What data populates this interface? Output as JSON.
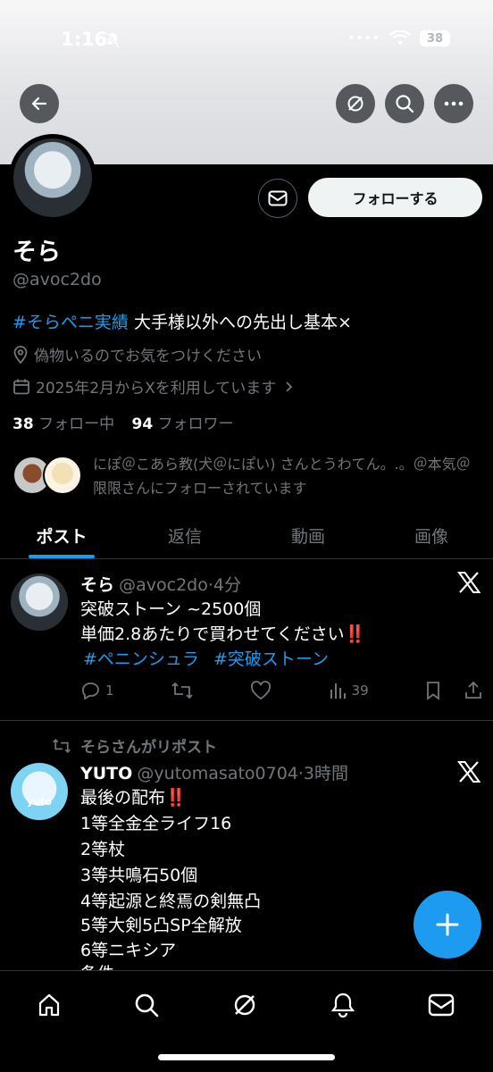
{
  "status_bar": {
    "time": "1:16",
    "battery": "38"
  },
  "profile": {
    "name": "そら",
    "handle": "@avoc2do",
    "bio_hashtag": "#そらペニ実績",
    "bio_text": " 大手様以外への先出し基本×",
    "location": "偽物いるのでお気をつけください",
    "joined": "2025年2月からXを利用しています",
    "following_count": "38",
    "following_label": " フォロー中",
    "followers_count": "94",
    "followers_label": " フォロワー",
    "followed_by": "にぽ＠こあら教(犬＠にぽい) さんとうわてん。.。＠本気＠限限さんにフォローされています",
    "follow_button": "フォローする"
  },
  "tabs": [
    "ポスト",
    "返信",
    "動画",
    "画像"
  ],
  "posts": [
    {
      "name": "そら",
      "handle": "@avoc2do",
      "time": "·4分",
      "lines": [
        "突破ストーン ~2500個",
        "単価2.8あたりで買わせてください‼️"
      ],
      "hashtags": [
        "#ペニンシュラ",
        "#突破ストーン"
      ],
      "replies": "1",
      "views": "39"
    },
    {
      "repost_label": "そらさんがリポスト",
      "name": "YUTO",
      "handle": "@yutomasato0704",
      "time": "·3時間",
      "avatar_text": "yuto",
      "lines": [
        "最後の配布‼️",
        "1等全金全ライフ16",
        "2等杖",
        "3等共鳴石50個",
        "4等起源と終焉の剣無凸",
        "5等大剣5凸SP全解放",
        "6等ニキシア",
        "条件"
      ]
    }
  ],
  "colors": {
    "accent": "#1d9bf0",
    "muted": "#71767b",
    "divider": "#2f3336"
  },
  "icons": [
    "back-arrow-icon",
    "grok-icon",
    "search-icon",
    "more-icon",
    "mail-icon",
    "location-icon",
    "calendar-icon",
    "x-logo-icon",
    "reply-icon",
    "repost-icon",
    "like-icon",
    "views-icon",
    "bookmark-icon",
    "share-icon",
    "plus-icon",
    "home-icon",
    "bell-icon"
  ]
}
